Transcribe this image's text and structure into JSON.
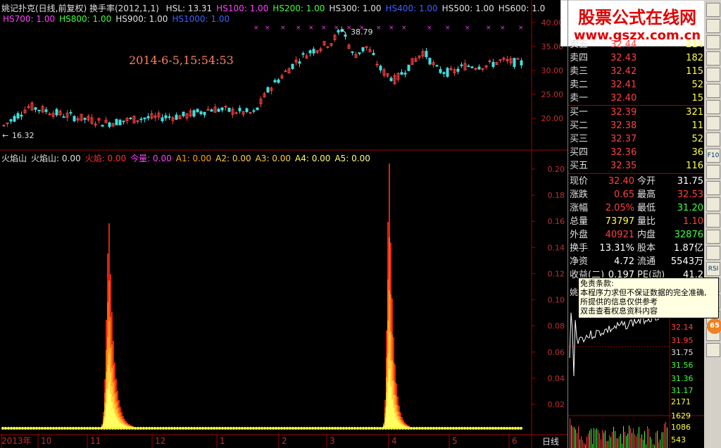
{
  "header": {
    "title": "姚记扑克(日线,前复权) 换手率(2012,1,1)",
    "row1": [
      {
        "label": "HSL: 13.31",
        "color": "#e0e0e0"
      },
      {
        "label": "HS100: 1.00",
        "color": "#ff40ff"
      },
      {
        "label": "HS200: 1.00",
        "color": "#40ff40"
      },
      {
        "label": "HS300: 1.00",
        "color": "#e0e0e0"
      },
      {
        "label": "HS400: 1.00",
        "color": "#4060ff"
      },
      {
        "label": "HS500: 1.00",
        "color": "#e0e0e0"
      },
      {
        "label": "HS600: 1.0",
        "color": "#e0e0e0"
      }
    ],
    "row2": [
      {
        "label": "HS700: 1.00",
        "color": "#ff40ff"
      },
      {
        "label": "HS800: 1.00",
        "color": "#40ff40"
      },
      {
        "label": "HS900: 1.00",
        "color": "#e0e0e0"
      },
      {
        "label": "HS1000: 1.00",
        "color": "#4060ff"
      }
    ]
  },
  "price_chart": {
    "datetime": "2014-6-5,15:54:53",
    "high_label": "38.79",
    "low_label": "16.32",
    "y_ticks": [
      "40.00",
      "35.00",
      "30.00",
      "25.00",
      "20.00"
    ]
  },
  "indicator": {
    "labels": [
      {
        "label": "火焰山",
        "color": "#e0e0e0"
      },
      {
        "label": "火焰山: 0.00",
        "color": "#e0e0e0"
      },
      {
        "label": "火焰: 0.00",
        "color": "#ff3030"
      },
      {
        "label": "今量: 0.00",
        "color": "#ff40ff"
      },
      {
        "label": "A1: 0.00",
        "color": "#ffa020"
      },
      {
        "label": "A2: 0.00",
        "color": "#ffd040"
      },
      {
        "label": "A3: 0.00",
        "color": "#ffd040"
      },
      {
        "label": "A4: 0.00",
        "color": "#ffff60"
      },
      {
        "label": "A5: 0.00",
        "color": "#ffff80"
      }
    ],
    "y_ticks": [
      "0.20",
      "0.18",
      "0.16",
      "0.14",
      "0.12",
      "0.10",
      "0.08",
      "0.06",
      "0.04",
      "0.02"
    ]
  },
  "x_axis": {
    "labels": [
      "2013年",
      "10",
      "11",
      "12",
      "1",
      "2",
      "3",
      "4",
      "5",
      "6"
    ],
    "period": "日线"
  },
  "watermark": {
    "line1": "股票公式在线网",
    "line2": "www.gszx.com.cn"
  },
  "order_book": {
    "sell": [
      {
        "label": "卖五",
        "price": "32.44",
        "vol": "214"
      },
      {
        "label": "卖四",
        "price": "32.43",
        "vol": "182"
      },
      {
        "label": "卖三",
        "price": "32.42",
        "vol": "115"
      },
      {
        "label": "卖二",
        "price": "32.41",
        "vol": "52"
      },
      {
        "label": "卖一",
        "price": "32.40",
        "vol": "15"
      }
    ],
    "buy": [
      {
        "label": "买一",
        "price": "32.39",
        "vol": "321"
      },
      {
        "label": "买二",
        "price": "32.38",
        "vol": "11"
      },
      {
        "label": "买三",
        "price": "32.37",
        "vol": "52"
      },
      {
        "label": "买四",
        "price": "32.36",
        "vol": "36"
      },
      {
        "label": "买五",
        "price": "32.35",
        "vol": "116"
      }
    ]
  },
  "stats": [
    {
      "l1": "现价",
      "v1": "32.40",
      "c1": "#ff4040",
      "l2": "今开",
      "v2": "31.75",
      "c2": "#ffffff"
    },
    {
      "l1": "涨跌",
      "v1": "0.65",
      "c1": "#ff4040",
      "l2": "最高",
      "v2": "32.53",
      "c2": "#ff4040"
    },
    {
      "l1": "涨幅",
      "v1": "2.05%",
      "c1": "#ff4040",
      "l2": "最低",
      "v2": "31.20",
      "c2": "#40ff40"
    },
    {
      "l1": "总量",
      "v1": "73797",
      "c1": "#ffff40",
      "l2": "量比",
      "v2": "1.10",
      "c2": "#ff4040"
    },
    {
      "l1": "外盘",
      "v1": "40921",
      "c1": "#ff4040",
      "l2": "内盘",
      "v2": "32876",
      "c2": "#40ff40"
    },
    {
      "l1": "换手",
      "v1": "13.31%",
      "c1": "#ffffff",
      "l2": "股本",
      "v2": "1.87亿",
      "c2": "#ffffff"
    },
    {
      "l1": "净资",
      "v1": "4.72",
      "c1": "#ffffff",
      "l2": "流通",
      "v2": "5543万",
      "c2": "#ffffff"
    },
    {
      "l1": "收益(二)",
      "v1": "0.197",
      "c1": "#ffffff",
      "l2": "PE(动)",
      "v2": "41.2",
      "c2": "#ffffff"
    }
  ],
  "tooltip": {
    "title": "免责条款:",
    "lines": [
      "本程序力求但不保证数据的完全准确,",
      "所提供的信息仅供参考",
      "双击查看权息资料内容"
    ]
  },
  "mini_chart": {
    "label": "姚",
    "price_ticks": [
      {
        "v": "32.14",
        "c": "#ff4040"
      },
      {
        "v": "31.95",
        "c": "#ff4040"
      },
      {
        "v": "31.75",
        "c": "#e0e0e0"
      },
      {
        "v": "31.56",
        "c": "#40ff40"
      },
      {
        "v": "31.36",
        "c": "#40ff40"
      },
      {
        "v": "31.17",
        "c": "#40ff40"
      }
    ],
    "vol_ticks": [
      "2171",
      "1629",
      "1086",
      "543"
    ]
  },
  "toolbar": {
    "buttons": [
      "",
      "",
      "",
      "",
      "",
      "",
      "",
      "",
      "",
      "F10",
      "",
      "",
      "",
      "",
      "",
      "",
      "RSI",
      "",
      "",
      "",
      "",
      ""
    ],
    "badge": "65"
  }
}
